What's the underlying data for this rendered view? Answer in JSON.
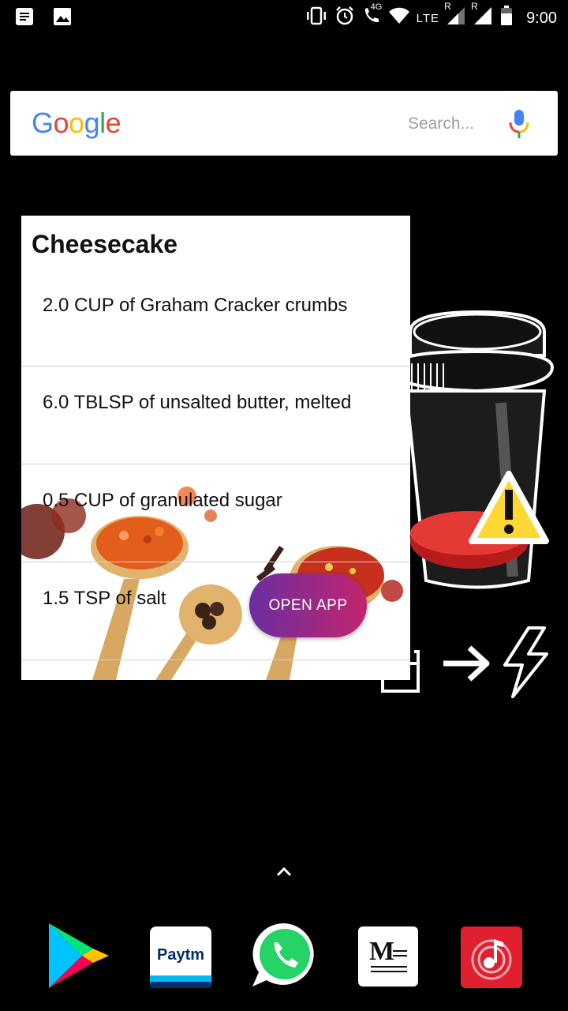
{
  "status_bar": {
    "network_type": "4G",
    "lte_label": "LTE",
    "roaming_1": "R",
    "roaming_2": "R",
    "time": "9:00"
  },
  "search_widget": {
    "logo_letters": [
      "G",
      "o",
      "o",
      "g",
      "l",
      "e"
    ],
    "logo_colors": [
      "#4285F4",
      "#EA4335",
      "#FBBC05",
      "#4285F4",
      "#34A853",
      "#EA4335"
    ],
    "placeholder": "Search..."
  },
  "recipe_widget": {
    "title": "Cheesecake",
    "ingredients": [
      "2.0 CUP of Graham Cracker crumbs",
      "6.0 TBLSP of unsalted butter, melted",
      "0.5 CUP of granulated sugar",
      "1.5 TSP of salt"
    ],
    "open_button_label": "OPEN APP"
  },
  "dock": {
    "apps": [
      "play-store-icon",
      "paytm-icon",
      "whatsapp-icon",
      "medium-icon",
      "music-icon"
    ],
    "paytm_text": "Paytm",
    "medium_text": "M"
  },
  "colors": {
    "button_gradient_start": "#6a2ea0",
    "button_gradient_end": "#c2256e"
  }
}
